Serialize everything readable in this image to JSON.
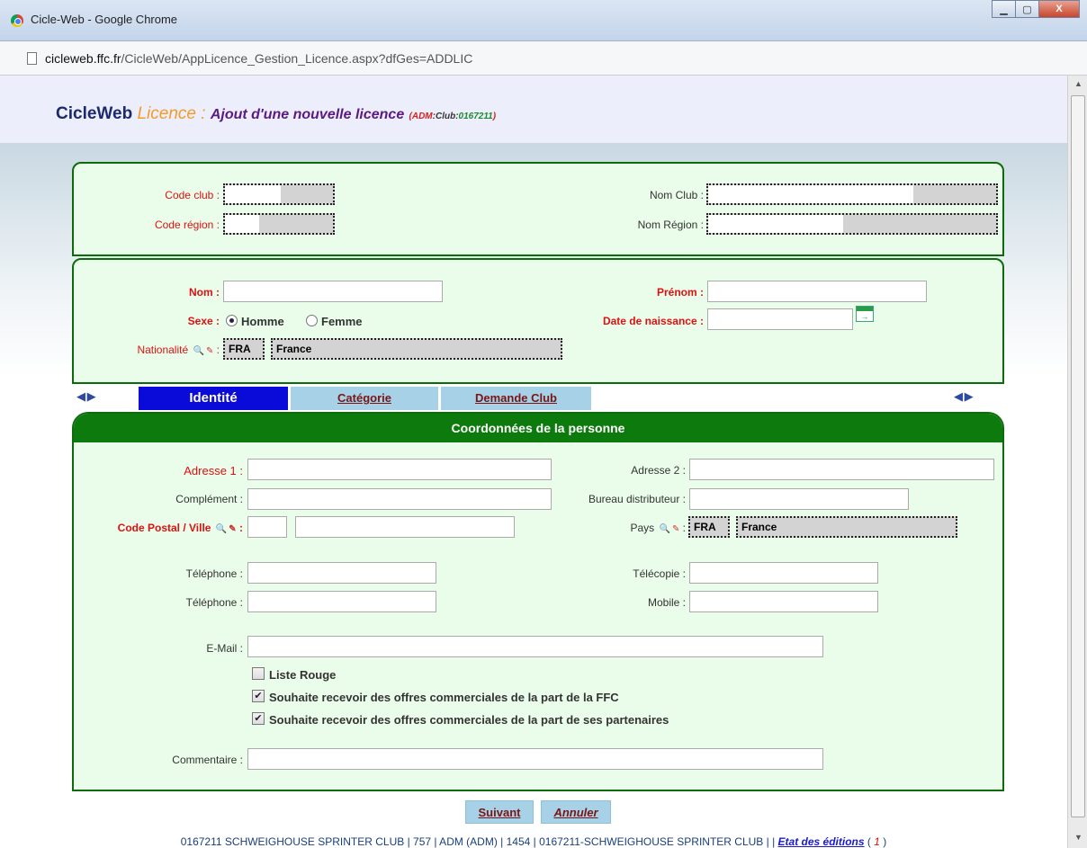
{
  "window": {
    "title": "Cicle-Web - Google Chrome",
    "minimize": "▁",
    "maximize": "▢",
    "close": "X"
  },
  "address": {
    "host": "cicleweb.ffc.fr",
    "path": "/CicleWeb/AppLicence_Gestion_Licence.aspx?dfGes=ADDLIC"
  },
  "header": {
    "brand": "CicleWeb",
    "module": "Licence",
    "separator": " : ",
    "action": "Ajout d'une nouvelle licence",
    "ctx_open": "(",
    "ctx_adm": "ADM",
    "ctx_colon1": ":",
    "ctx_club": "Club",
    "ctx_colon2": ":",
    "ctx_code": "0167211",
    "ctx_close": ")"
  },
  "club": {
    "code_club_label": "Code club :",
    "code_region_label": "Code région :",
    "nom_club_label": "Nom Club :",
    "nom_region_label": "Nom Région :"
  },
  "person": {
    "nom_label": "Nom :",
    "prenom_label": "Prénom :",
    "sexe_label": "Sexe :",
    "sexe_options": [
      "Homme",
      "Femme"
    ],
    "sexe_selected": "Homme",
    "naissance_label": "Date de naissance :",
    "nationalite_label": "Nationalité",
    "nationalite_suffix": " :",
    "nationalite_code": "FRA",
    "nationalite_name": "France"
  },
  "tabs": [
    {
      "label": "Identité",
      "active": true
    },
    {
      "label": "Catégorie",
      "active": false
    },
    {
      "label": "Demande Club",
      "active": false
    }
  ],
  "nav_arrows": "◀ ▶",
  "coord": {
    "title": "Coordonnées de la personne",
    "adresse1_label": "Adresse 1 :",
    "adresse2_label": "Adresse 2 :",
    "complement_label": "Complément :",
    "bureau_label": "Bureau distributeur :",
    "cp_ville_label": "Code Postal / Ville",
    "cp_suffix": " :",
    "pays_label": "Pays",
    "pays_suffix": " :",
    "pays_code": "FRA",
    "pays_name": "France",
    "tel1_label": "Téléphone :",
    "telecopie_label": "Télécopie :",
    "tel2_label": "Téléphone :",
    "mobile_label": "Mobile :",
    "email_label": "E-Mail :",
    "liste_rouge": "Liste Rouge",
    "offres_ffc": "Souhaite recevoir des offres commerciales de la part de la FFC",
    "offres_partenaires": "Souhaite recevoir des offres commerciales de la part de ses partenaires",
    "commentaire_label": "Commentaire :"
  },
  "buttons": {
    "suivant": "Suivant",
    "annuler": "Annuler"
  },
  "footer": {
    "text": "0167211 SCHWEIGHOUSE SPRINTER CLUB | 757 | ADM (ADM) | 1454 | 0167211-SCHWEIGHOUSE SPRINTER CLUB | | ",
    "link": "Etat des éditions",
    "count_open": " ( ",
    "count": "1",
    "count_close": " )"
  },
  "colors": {
    "panel_border": "#0d6b0d",
    "panel_bg": "#eafdea",
    "tab_active": "#0b0bd9",
    "tab_inactive": "#a6d1e6",
    "required": "#d11111"
  },
  "icons": {
    "search": "magnifier-icon",
    "clear": "eraser-icon",
    "calendar": "calendar-icon"
  }
}
